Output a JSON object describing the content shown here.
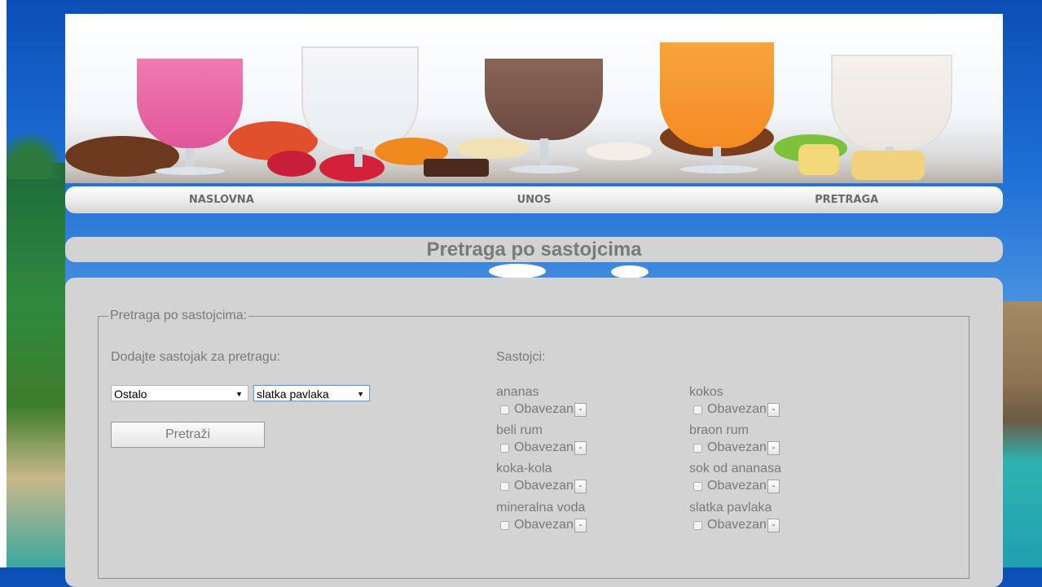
{
  "nav": {
    "items": [
      {
        "label": "NASLOVNA"
      },
      {
        "label": "UNOS"
      },
      {
        "label": "PRETRAGA"
      }
    ]
  },
  "page": {
    "title": "Pretraga po sastojcima"
  },
  "form": {
    "legend": "Pretraga po sastojcima:",
    "add_label": "Dodajte sastojak za pretragu:",
    "category_select": {
      "value": "Ostalo"
    },
    "ingredient_select": {
      "value": "slatka pavlaka"
    },
    "search_button": "Pretraži"
  },
  "ingredients": {
    "title": "Sastojci:",
    "required_label": "Obavezan",
    "remove_label": "-",
    "items": [
      {
        "name": "ananas"
      },
      {
        "name": "kokos"
      },
      {
        "name": "beli rum"
      },
      {
        "name": "braon rum"
      },
      {
        "name": "koka-kola"
      },
      {
        "name": "sok od ananasa"
      },
      {
        "name": "mineralna voda"
      },
      {
        "name": "slatka pavlaka"
      }
    ]
  },
  "colors": {
    "accent_focus": "#6c9bd8",
    "panel": "#d3d3d3",
    "text": "#7a7a7a"
  }
}
